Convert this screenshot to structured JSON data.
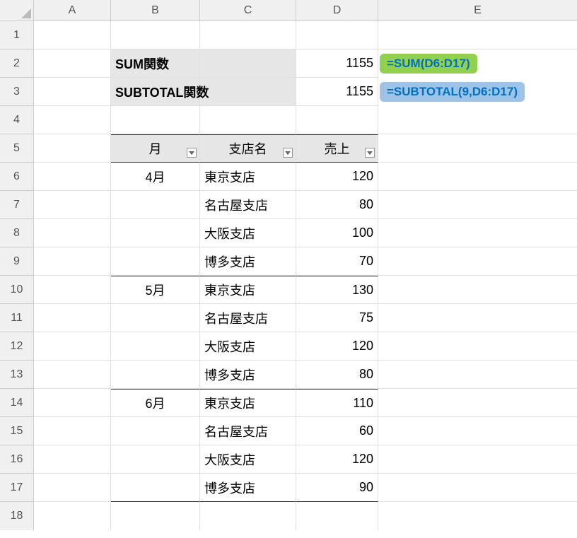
{
  "columns": [
    "A",
    "B",
    "C",
    "D",
    "E"
  ],
  "rows": [
    "1",
    "2",
    "3",
    "4",
    "5",
    "6",
    "7",
    "8",
    "9",
    "10",
    "11",
    "12",
    "13",
    "14",
    "15",
    "16",
    "17",
    "18"
  ],
  "summary": {
    "sum_label": "SUM関数",
    "sum_value": "1155",
    "sum_formula": "=SUM(D6:D17)",
    "subtotal_label": "SUBTOTAL関数",
    "subtotal_value": "1155",
    "subtotal_formula": "=SUBTOTAL(9,D6:D17)"
  },
  "table": {
    "headers": {
      "month": "月",
      "branch": "支店名",
      "sales": "売上"
    },
    "rows": [
      {
        "month": "4月",
        "branch": "東京支店",
        "sales": "120"
      },
      {
        "month": "",
        "branch": "名古屋支店",
        "sales": "80"
      },
      {
        "month": "",
        "branch": "大阪支店",
        "sales": "100"
      },
      {
        "month": "",
        "branch": "博多支店",
        "sales": "70"
      },
      {
        "month": "5月",
        "branch": "東京支店",
        "sales": "130"
      },
      {
        "month": "",
        "branch": "名古屋支店",
        "sales": "75"
      },
      {
        "month": "",
        "branch": "大阪支店",
        "sales": "120"
      },
      {
        "month": "",
        "branch": "博多支店",
        "sales": "80"
      },
      {
        "month": "6月",
        "branch": "東京支店",
        "sales": "110"
      },
      {
        "month": "",
        "branch": "名古屋支店",
        "sales": "60"
      },
      {
        "month": "",
        "branch": "大阪支店",
        "sales": "120"
      },
      {
        "month": "",
        "branch": "博多支店",
        "sales": "90"
      }
    ]
  }
}
